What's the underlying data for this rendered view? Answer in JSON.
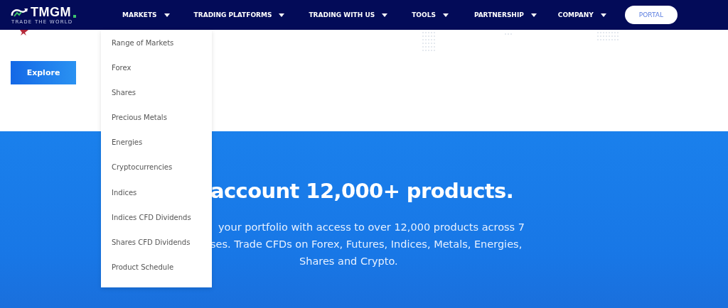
{
  "logo": {
    "name": "TMGM",
    "tagline": "TRADE THE WORLD"
  },
  "nav": [
    {
      "label": "MARKETS"
    },
    {
      "label": "TRADING PLATFORMS"
    },
    {
      "label": "TRADING WITH US"
    },
    {
      "label": "TOOLS"
    },
    {
      "label": "PARTNERSHIP"
    },
    {
      "label": "COMPANY"
    }
  ],
  "portal_button": "PORTAL",
  "explore_button": "Explore",
  "dropdown": [
    "Range of Markets",
    "Forex",
    "Shares",
    "Precious Metals",
    "Energies",
    "Cryptocurrencies",
    "Indices",
    "Indices CFD Dividends",
    "Shares CFD Dividends",
    "Product Schedule"
  ],
  "hero": {
    "headline": "account 12,000+ products.",
    "lines": [
      "your portfolio with access to over 12,000 products across 7",
      "ses. Trade CFDs on Forex, Futures, Indices, Metals, Energies,",
      "Shares and Crypto."
    ]
  }
}
